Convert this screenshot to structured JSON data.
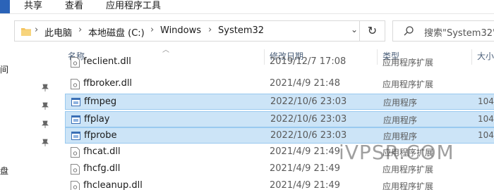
{
  "ribbon": {
    "tabs": [
      "共享",
      "查看",
      "应用程序工具"
    ]
  },
  "address": {
    "crumbs": [
      "此电脑",
      "本地磁盘 (C:)",
      "Windows",
      "System32"
    ],
    "separator": "›"
  },
  "search": {
    "placeholder": "搜索\"System32\""
  },
  "nav": {
    "fragments": [
      "间",
      "盘"
    ]
  },
  "columns": {
    "name": "名称",
    "date": "修改日期",
    "type": "类型",
    "size": "大小"
  },
  "files": [
    {
      "name": "feclient.dll",
      "date": "2019/12/7 17:08",
      "type": "应用程序扩展",
      "size": "",
      "selected": false,
      "kind": "dll"
    },
    {
      "name": "ffbroker.dll",
      "date": "2021/4/9 21:48",
      "type": "应用程序扩展",
      "size": "",
      "selected": false,
      "kind": "dll"
    },
    {
      "name": "ffmpeg",
      "date": "2022/10/6 23:03",
      "type": "应用程序",
      "size": "104",
      "selected": true,
      "kind": "exe"
    },
    {
      "name": "ffplay",
      "date": "2022/10/6 23:03",
      "type": "应用程序",
      "size": "104",
      "selected": true,
      "kind": "exe"
    },
    {
      "name": "ffprobe",
      "date": "2022/10/6 23:03",
      "type": "应用程序",
      "size": "104",
      "selected": true,
      "kind": "exe"
    },
    {
      "name": "fhcat.dll",
      "date": "2021/4/9 21:49",
      "type": "应用程序扩展",
      "size": "",
      "selected": false,
      "kind": "dll"
    },
    {
      "name": "fhcfg.dll",
      "date": "2021/4/9 21:49",
      "type": "应用程序扩展",
      "size": "",
      "selected": false,
      "kind": "dll"
    },
    {
      "name": "fhcleanup.dll",
      "date": "2021/4/9 21:49",
      "type": "应用程序扩展",
      "size": "",
      "selected": false,
      "kind": "dll"
    }
  ],
  "watermark": "iVPSR.COM",
  "colors": {
    "accent": "#2b63b8",
    "selection": "#cce4f7",
    "selection_border": "#99c9ef"
  },
  "icons": [
    "folder-icon",
    "refresh-icon",
    "search-icon",
    "pin-icon",
    "dll-file-icon",
    "exe-file-icon",
    "chevron-down-icon",
    "sort-up-icon"
  ]
}
